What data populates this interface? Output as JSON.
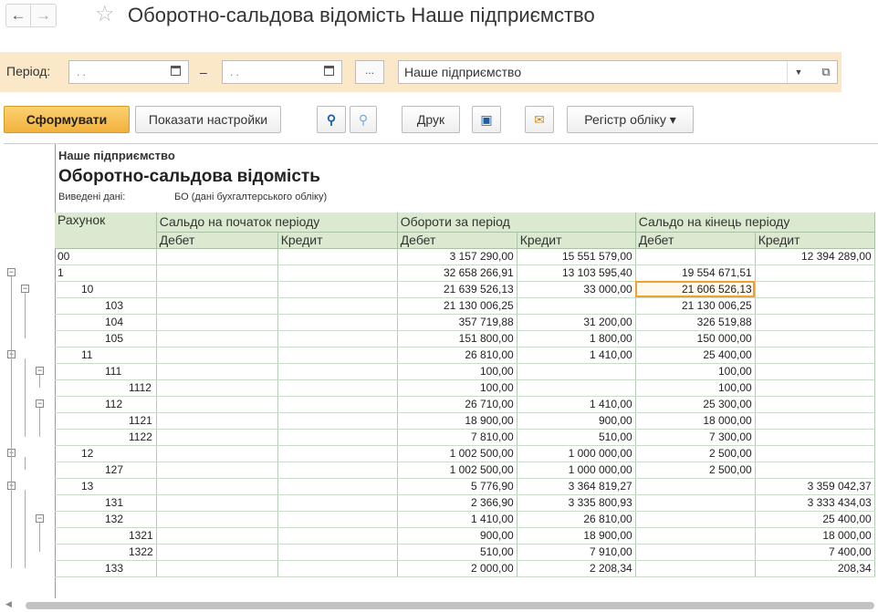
{
  "titlebar": {
    "title": "Оборотно-сальдова відомість Наше підприємство",
    "back": "←",
    "forward": "→",
    "star": "☆"
  },
  "period": {
    "label": "Період:",
    "date_from": ".  .",
    "date_to": ".  .",
    "dash": "–",
    "more": "...",
    "organization": "Наше підприємство"
  },
  "toolbar": {
    "generate": "Сформувати",
    "settings": "Показати настройки",
    "print": "Друк",
    "register": "Регістр обліку ▾"
  },
  "report": {
    "organization": "Наше підприємство",
    "title": "Оборотно-сальдова відомість",
    "output_label": "Виведені дані:",
    "output_value": "БО (дані бухгалтерського обліку)",
    "columns": {
      "account": "Рахунок",
      "opening": "Сальдо на початок періоду",
      "turnover": "Обороти за період",
      "closing": "Сальдо на кінець періоду",
      "debit": "Дебет",
      "credit": "Кредит"
    },
    "rows": [
      {
        "acc": "00",
        "ind": 0,
        "od": "",
        "oc": "",
        "td": "3 157 290,00",
        "tc": "15 551 579,00",
        "cd": "",
        "cc": "12 394 289,00"
      },
      {
        "acc": "1",
        "ind": 0,
        "od": "",
        "oc": "",
        "td": "32 658 266,91",
        "tc": "13 103 595,40",
        "cd": "19 554 671,51",
        "cc": ""
      },
      {
        "acc": "10",
        "ind": 1,
        "od": "",
        "oc": "",
        "td": "21 639 526,13",
        "tc": "33 000,00",
        "cd": "21 606 526,13",
        "cc": ""
      },
      {
        "acc": "103",
        "ind": 2,
        "od": "",
        "oc": "",
        "td": "21 130 006,25",
        "tc": "",
        "cd": "21 130 006,25",
        "cc": ""
      },
      {
        "acc": "104",
        "ind": 2,
        "od": "",
        "oc": "",
        "td": "357 719,88",
        "tc": "31 200,00",
        "cd": "326 519,88",
        "cc": ""
      },
      {
        "acc": "105",
        "ind": 2,
        "od": "",
        "oc": "",
        "td": "151 800,00",
        "tc": "1 800,00",
        "cd": "150 000,00",
        "cc": ""
      },
      {
        "acc": "11",
        "ind": 1,
        "od": "",
        "oc": "",
        "td": "26 810,00",
        "tc": "1 410,00",
        "cd": "25 400,00",
        "cc": ""
      },
      {
        "acc": "111",
        "ind": 2,
        "od": "",
        "oc": "",
        "td": "100,00",
        "tc": "",
        "cd": "100,00",
        "cc": ""
      },
      {
        "acc": "1112",
        "ind": 3,
        "od": "",
        "oc": "",
        "td": "100,00",
        "tc": "",
        "cd": "100,00",
        "cc": ""
      },
      {
        "acc": "112",
        "ind": 2,
        "od": "",
        "oc": "",
        "td": "26 710,00",
        "tc": "1 410,00",
        "cd": "25 300,00",
        "cc": ""
      },
      {
        "acc": "1121",
        "ind": 3,
        "od": "",
        "oc": "",
        "td": "18 900,00",
        "tc": "900,00",
        "cd": "18 000,00",
        "cc": ""
      },
      {
        "acc": "1122",
        "ind": 3,
        "od": "",
        "oc": "",
        "td": "7 810,00",
        "tc": "510,00",
        "cd": "7 300,00",
        "cc": ""
      },
      {
        "acc": "12",
        "ind": 1,
        "od": "",
        "oc": "",
        "td": "1 002 500,00",
        "tc": "1 000 000,00",
        "cd": "2 500,00",
        "cc": ""
      },
      {
        "acc": "127",
        "ind": 2,
        "od": "",
        "oc": "",
        "td": "1 002 500,00",
        "tc": "1 000 000,00",
        "cd": "2 500,00",
        "cc": ""
      },
      {
        "acc": "13",
        "ind": 1,
        "od": "",
        "oc": "",
        "td": "5 776,90",
        "tc": "3 364 819,27",
        "cd": "",
        "cc": "3 359 042,37"
      },
      {
        "acc": "131",
        "ind": 2,
        "od": "",
        "oc": "",
        "td": "2 366,90",
        "tc": "3 335 800,93",
        "cd": "",
        "cc": "3 333 434,03"
      },
      {
        "acc": "132",
        "ind": 2,
        "od": "",
        "oc": "",
        "td": "1 410,00",
        "tc": "26 810,00",
        "cd": "",
        "cc": "25 400,00"
      },
      {
        "acc": "1321",
        "ind": 3,
        "od": "",
        "oc": "",
        "td": "900,00",
        "tc": "18 900,00",
        "cd": "",
        "cc": "18 000,00"
      },
      {
        "acc": "1322",
        "ind": 3,
        "od": "",
        "oc": "",
        "td": "510,00",
        "tc": "7 910,00",
        "cd": "",
        "cc": "7 400,00"
      },
      {
        "acc": "133",
        "ind": 2,
        "od": "",
        "oc": "",
        "td": "2 000,00",
        "tc": "2 208,34",
        "cd": "",
        "cc": "208,34"
      }
    ]
  }
}
